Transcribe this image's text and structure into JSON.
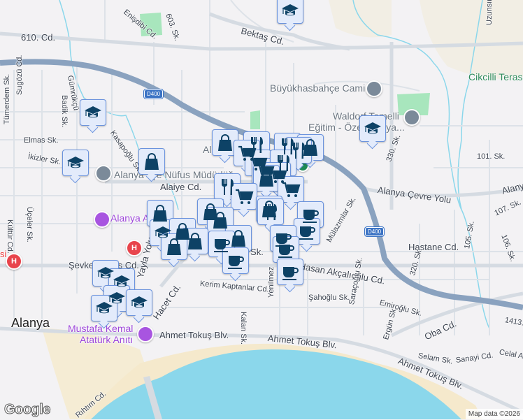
{
  "streets": {
    "s610": "610. Cd.",
    "enisdibi": "Enişdibi Cd.",
    "s603": "603. Sk.",
    "bektas": "Bektaş Cd.",
    "tumerdem": "Tümerdem Sk.",
    "sugozu": "Sugözü Cd.",
    "badik": "Badik Sk.",
    "gumrukcu": "Gümrükçü",
    "kasapoglu": "Kasapoğlu Sk.",
    "elmas": "Elmas Sk.",
    "ikizler": "İkizler Sk.",
    "alaiye": "Alaiye Cd.",
    "uzunsirt": "Uzunsırt Cd.",
    "s330": "330. Sk.",
    "s101": "101. Sk.",
    "cevre": "Alanya Çevre Yolu",
    "cevre2": "Alanya",
    "s107": "107. Sk.",
    "s105": "105. Sk.",
    "s106": "106. Sk.",
    "hastane": "Hastane Cd.",
    "s320": "320. Sk.",
    "mulazimlar": "Mülazımlar Sk.",
    "hasan": "Hasan Akçalıoğlu Cd.",
    "sahoglu": "Şahoğlu Sk.",
    "saracoglu": "Saraçoğlu Sk.",
    "emiroglu": "Emiroğlu Sk.",
    "ergun": "Ergün Sk.",
    "oba": "Oba Cd.",
    "selam": "Selam Sk.",
    "sanayi": "Sanayi Cd.",
    "celal": "Celal A",
    "s1413": "1413.",
    "ahmet1": "Ahmet Tokuş Blv.",
    "ahmet2": "Ahmet Tokuş Blv.",
    "ahmet3": "Ahmet Tokuş Blv.",
    "sevket": "Şevket Tokuş Cd.",
    "yayla": "Yayla Yolu",
    "hacet": "Hacet Cd.",
    "kerim": "Kerim Kaptanlar Cd.",
    "kalan": "Kalan Sk.",
    "yenilmez": "Yenilmez",
    "kultur": "Kültür Cd.",
    "uceler": "Üçeler Sk.",
    "rihtim": "Rıhtım Cd.",
    "ler": "ler Sk.",
    "d400a": "D400",
    "d400b": "D400"
  },
  "places": {
    "city": "Alanya",
    "mosque": "Büyükhasbahçe Cami",
    "school1": "Waldorf Temelli",
    "school2": "Eğitim - Özel Alanya...",
    "nufus": "Alanya İlçe Nüfus Müdürlüğü",
    "museum": "Alanya A",
    "ataturk1": "Mustafa Kemal",
    "ataturk2": "Atatürk Anıtı",
    "cikcilli": "Cikcilli Teras",
    "hospital_left": "si",
    "hospital_glyph": "H",
    "al": "Al"
  },
  "footer": {
    "logo": "Google",
    "attribution": "Map data ©2026"
  },
  "colors": {
    "water": "#8bd7eb",
    "highway": "#8aa2bf",
    "marker_fill": "#e3ebfb",
    "marker_icon": "#0d4266",
    "park": "#a8e6bd",
    "beach": "#f5e9cc"
  }
}
